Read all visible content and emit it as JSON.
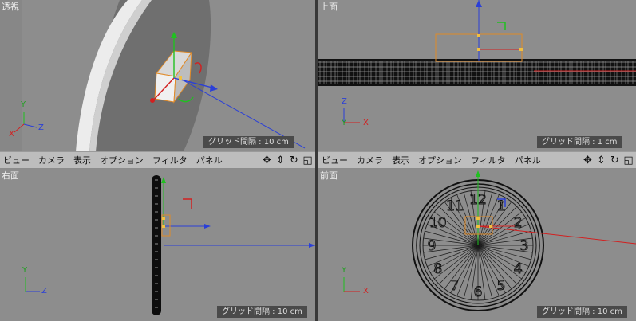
{
  "viewports": {
    "perspective": {
      "label": "透視",
      "grid": "グリッド間隔 : 10 cm"
    },
    "top": {
      "label": "上面",
      "grid": "グリッド間隔 : 1 cm"
    },
    "right": {
      "label": "右面",
      "grid": "グリッド間隔 : 10 cm"
    },
    "front": {
      "label": "前面",
      "grid": "グリッド間隔 : 10 cm"
    }
  },
  "menu": {
    "items": [
      "ビュー",
      "カメラ",
      "表示",
      "オプション",
      "フィルタ",
      "パネル"
    ]
  },
  "axes": {
    "x": "X",
    "y": "Y",
    "z": "Z"
  },
  "clock_numbers": [
    "12",
    "1",
    "2",
    "3",
    "4",
    "5",
    "6",
    "7",
    "8",
    "9",
    "10",
    "11"
  ],
  "icons": [
    "move-view-icon",
    "dolly-view-icon",
    "rotate-view-icon",
    "toggle-layout-icon"
  ],
  "colors": {
    "viewport_bg": "#898989",
    "menubar_bg": "#bdbdbd",
    "selection": "#e08a28",
    "axis_x": "#d22020",
    "axis_y": "#20c020",
    "axis_z": "#2a3fd8"
  }
}
